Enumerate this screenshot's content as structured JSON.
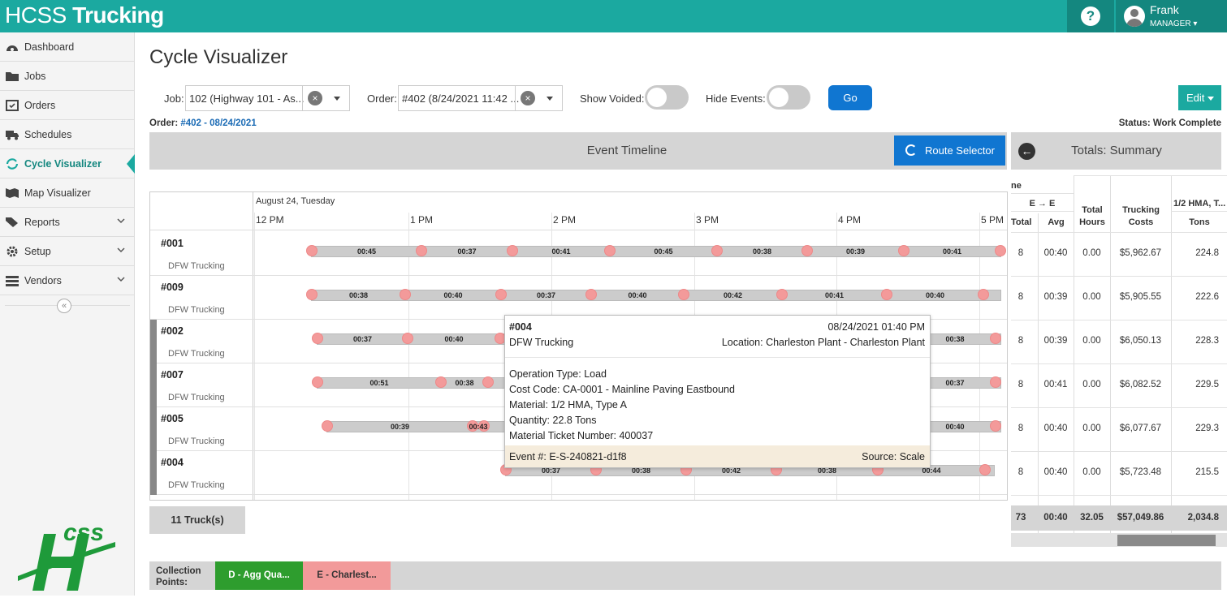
{
  "app": {
    "brand_light": "HCSS",
    "brand_bold": "Trucking",
    "help": "?",
    "user_name": "Frank",
    "user_role": "MANAGER"
  },
  "sidebar": {
    "items": [
      {
        "label": "Dashboard",
        "icon": "dashboard-icon"
      },
      {
        "label": "Jobs",
        "icon": "folder-icon"
      },
      {
        "label": "Orders",
        "icon": "calendar-icon"
      },
      {
        "label": "Schedules",
        "icon": "truck-icon"
      },
      {
        "label": "Cycle Visualizer",
        "icon": "refresh-icon",
        "active": true
      },
      {
        "label": "Map Visualizer",
        "icon": "map-icon"
      },
      {
        "label": "Reports",
        "icon": "tag-icon",
        "expand": true
      },
      {
        "label": "Setup",
        "icon": "gear-icon",
        "expand": true
      },
      {
        "label": "Vendors",
        "icon": "list-icon",
        "expand": true
      }
    ],
    "collapse": "«"
  },
  "page": {
    "title": "Cycle Visualizer",
    "job_label": "Job:",
    "job_value": "102 (Highway 101 - As...",
    "order_label": "Order:",
    "order_value": "#402 (8/24/2021 11:42 ...",
    "show_voided_label": "Show Voided:",
    "hide_events_label": "Hide Events:",
    "go": "Go",
    "edit": "Edit",
    "order_prefix": "Order:",
    "order_link": "#402 - 08/24/2021",
    "status": "Status: Work Complete"
  },
  "timeline": {
    "title": "Event Timeline",
    "route_selector": "Route Selector",
    "date": "August 24, Tuesday",
    "hours": [
      "12 PM",
      "1 PM",
      "2 PM",
      "3 PM",
      "4 PM",
      "5 PM"
    ],
    "trucks_count": "11 Truck(s)",
    "lanes": [
      {
        "id": "#001",
        "company": "DFW Trucking",
        "segments": [
          "00:45",
          "00:37",
          "00:41",
          "00:45",
          "00:38",
          "00:39",
          "00:41"
        ]
      },
      {
        "id": "#009",
        "company": "DFW Trucking",
        "segments": [
          "00:38",
          "00:40",
          "00:37",
          "00:40",
          "00:42",
          "00:41",
          "00:40"
        ]
      },
      {
        "id": "#002",
        "company": "DFW Trucking",
        "segments": [
          "00:37",
          "00:40",
          "00:38"
        ]
      },
      {
        "id": "#007",
        "company": "DFW Trucking",
        "segments": [
          "00:51",
          "00:38",
          "00:37"
        ]
      },
      {
        "id": "#005",
        "company": "DFW Trucking",
        "segments": [
          "00:39",
          "00:43",
          "00:40"
        ]
      },
      {
        "id": "#004",
        "company": "DFW Trucking",
        "segments": [
          "00:37",
          "00:38",
          "00:42",
          "00:38",
          "00:44"
        ]
      }
    ]
  },
  "tooltip": {
    "truck": "#004",
    "datetime": "08/24/2021 01:40 PM",
    "company": "DFW Trucking",
    "location": "Location: Charleston Plant - Charleston Plant",
    "details": [
      "Operation Type: Load",
      "Cost Code: CA-0001 - Mainline Paving Eastbound",
      "Material: 1/2 HMA, Type A",
      "Quantity: 22.8 Tons",
      "Material Ticket Number: 400037"
    ],
    "event": "Event #: E-S-240821-d1f8",
    "source": "Source: Scale"
  },
  "totals": {
    "title": "Totals: Summary",
    "partial_header": "ne",
    "ee_header": "E → E",
    "headers": {
      "total": "Total",
      "avg": "Avg",
      "total_hours": "Total Hours",
      "trucking_costs": "Trucking Costs",
      "hma": "1/2 HMA, T...",
      "tons": "Tons"
    },
    "rows": [
      {
        "total": "8",
        "avg": "00:40",
        "hours": "0.00",
        "cost": "$5,962.67",
        "tons": "224.8"
      },
      {
        "total": "8",
        "avg": "00:39",
        "hours": "0.00",
        "cost": "$5,905.55",
        "tons": "222.6"
      },
      {
        "total": "8",
        "avg": "00:39",
        "hours": "0.00",
        "cost": "$6,050.13",
        "tons": "228.3"
      },
      {
        "total": "8",
        "avg": "00:41",
        "hours": "0.00",
        "cost": "$6,082.52",
        "tons": "229.5"
      },
      {
        "total": "8",
        "avg": "00:40",
        "hours": "0.00",
        "cost": "$6,077.67",
        "tons": "229.3"
      },
      {
        "total": "8",
        "avg": "00:40",
        "hours": "0.00",
        "cost": "$5,723.48",
        "tons": "215.5"
      }
    ],
    "footer": {
      "total": "73",
      "avg": "00:40",
      "hours": "32.05",
      "cost": "$57,049.86",
      "tons": "2,034.8"
    }
  },
  "collection": {
    "label": "Collection Points:",
    "points": [
      {
        "label": "D - Agg Qua...",
        "color": "#2e9d2e"
      },
      {
        "label": "E - Charlest...",
        "color": "#f29a9a"
      }
    ]
  }
}
